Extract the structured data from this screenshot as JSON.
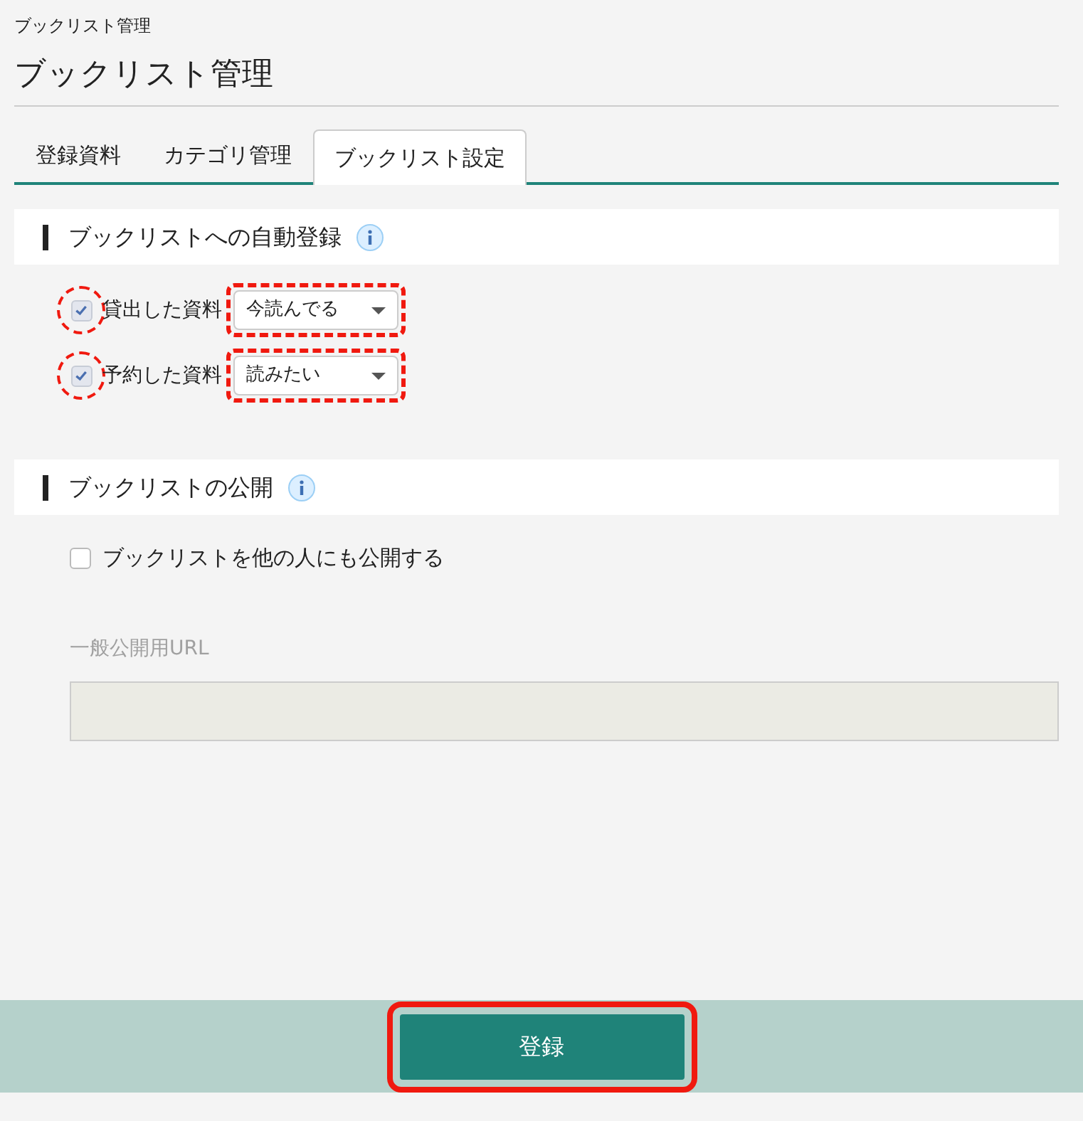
{
  "breadcrumb": "ブックリスト管理",
  "title": "ブックリスト管理",
  "tabs": [
    {
      "label": "登録資料",
      "selected": false
    },
    {
      "label": "カテゴリ管理",
      "selected": false
    },
    {
      "label": "ブックリスト設定",
      "selected": true
    }
  ],
  "auto_register": {
    "heading": "ブックリストへの自動登録",
    "rows": [
      {
        "label": "貸出した資料",
        "checked": true,
        "highlighted": true,
        "select": {
          "value": "今読んでる",
          "highlighted": true
        }
      },
      {
        "label": "予約した資料",
        "checked": true,
        "highlighted": true,
        "select": {
          "value": "読みたい",
          "highlighted": true
        }
      }
    ]
  },
  "publish": {
    "heading": "ブックリストの公開",
    "checkbox": {
      "label": "ブックリストを他の人にも公開する",
      "checked": false
    },
    "url_field": {
      "label": "一般公開用URL",
      "disabled": true
    }
  },
  "submit_button": {
    "label": "登録",
    "highlighted": true
  }
}
